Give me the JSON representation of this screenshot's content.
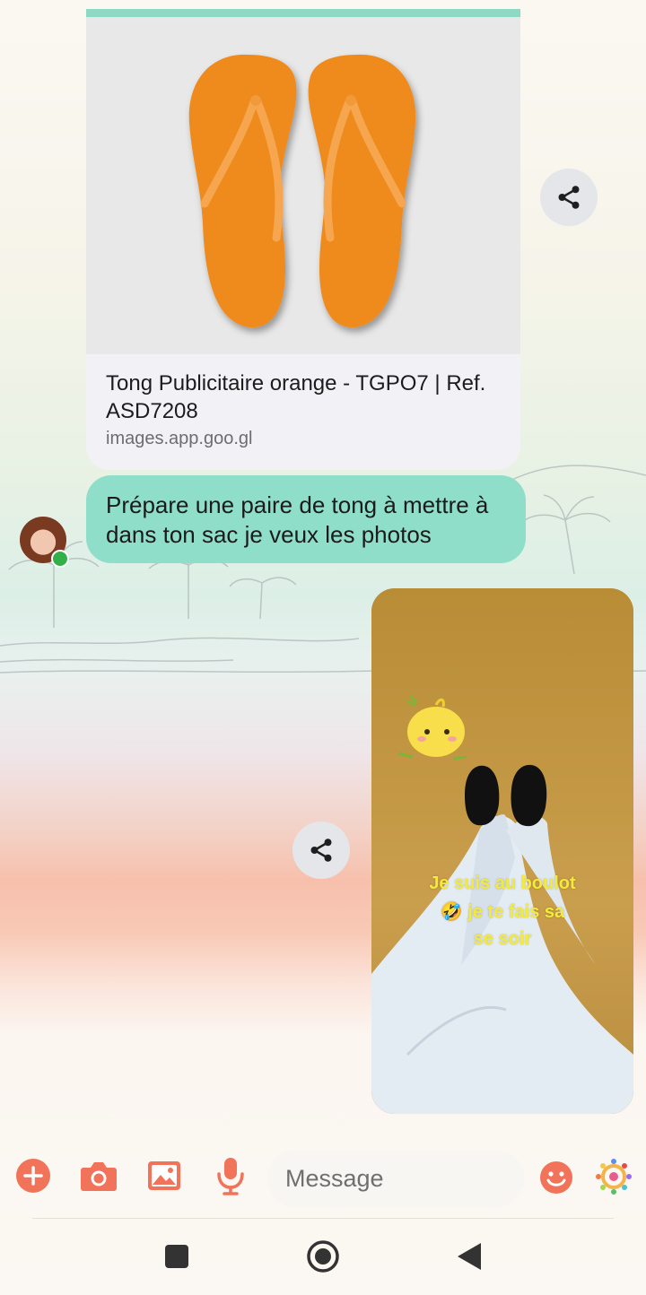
{
  "link_preview": {
    "title": "Tong Publicitaire orange - TGPO7 | Ref. ASD7208",
    "url": "images.app.goo.gl"
  },
  "message_incoming": {
    "text": "Prépare une paire de tong à mettre à dans ton sac je veux les photos"
  },
  "photo_message": {
    "caption_line1": "Je suis au boulot",
    "caption_line2": "🤣 je te fais sa",
    "caption_line3": "se soir"
  },
  "compose": {
    "placeholder": "Message"
  },
  "icons": {
    "share": "share-icon",
    "add": "add-icon",
    "camera": "camera-icon",
    "gallery": "image-icon",
    "mic": "microphone-icon",
    "emoji": "emoji-icon",
    "sticker": "sticker-icon"
  },
  "colors": {
    "accent": "#f0735a",
    "incoming_bubble": "#8fdec9"
  }
}
